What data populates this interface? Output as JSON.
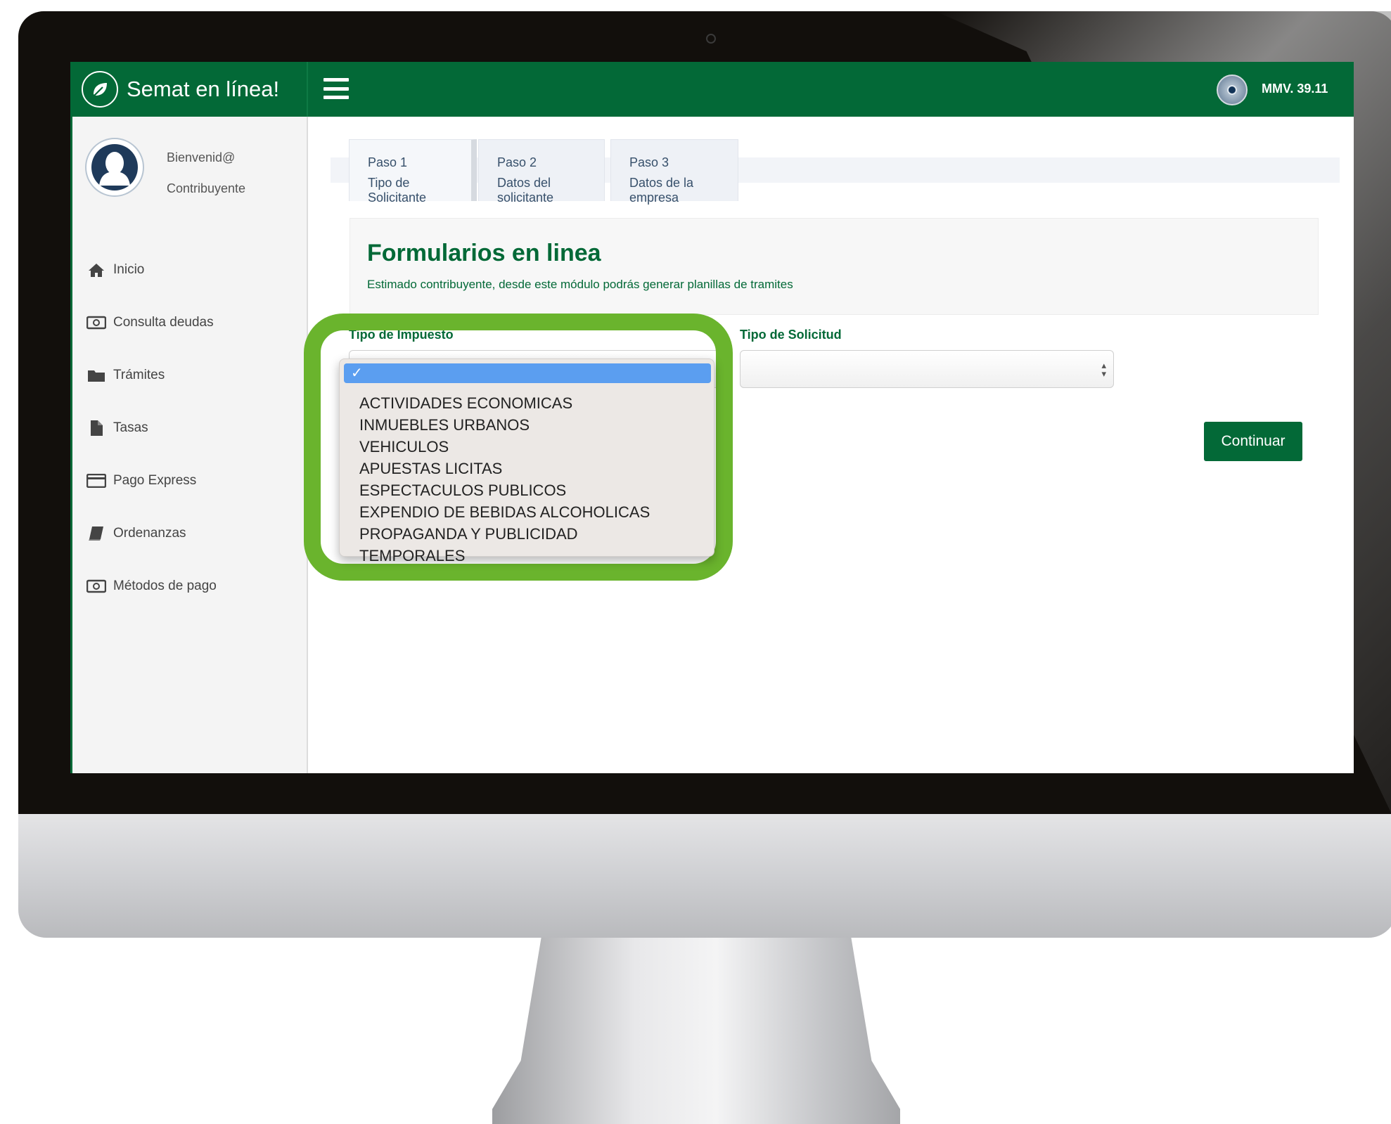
{
  "header": {
    "brand_name": "Semat en línea!",
    "user_code": "MMV. 39.11"
  },
  "sidebar": {
    "welcome": "Bienvenid@",
    "role": "Contribuyente",
    "items": [
      {
        "label": "Inicio",
        "icon": "home-icon"
      },
      {
        "label": "Consulta deudas",
        "icon": "banknote-icon"
      },
      {
        "label": "Trámites",
        "icon": "folder-icon"
      },
      {
        "label": "Tasas",
        "icon": "file-icon"
      },
      {
        "label": "Pago Express",
        "icon": "credit-card-icon"
      },
      {
        "label": "Ordenanzas",
        "icon": "book-icon"
      },
      {
        "label": "Métodos de pago",
        "icon": "banknote-icon"
      }
    ]
  },
  "tabs": [
    {
      "step": "Paso 1",
      "name": "Tipo de Solicitante"
    },
    {
      "step": "Paso 2",
      "name": "Datos del solicitante"
    },
    {
      "step": "Paso 3",
      "name": "Datos de la empresa"
    }
  ],
  "intro": {
    "title": "Formularios en linea",
    "text": "Estimado contribuyente, desde este módulo podrás generar planillas de tramites"
  },
  "form": {
    "tax_type_label": "Tipo de Impuesto",
    "request_type_label": "Tipo de Solicitud",
    "continue_label": "Continuar",
    "dropdown_selected_mark": "✓",
    "tax_options": [
      "ACTIVIDADES ECONOMICAS",
      "INMUEBLES URBANOS",
      "VEHICULOS",
      "APUESTAS LICITAS",
      "ESPECTACULOS PUBLICOS",
      "EXPENDIO DE BEBIDAS ALCOHOLICAS",
      "PROPAGANDA Y PUBLICIDAD",
      "TEMPORALES"
    ]
  },
  "colors": {
    "brand_green": "#036937",
    "highlight_green": "#6ab42d",
    "dropdown_selection": "#5b9ef0"
  }
}
